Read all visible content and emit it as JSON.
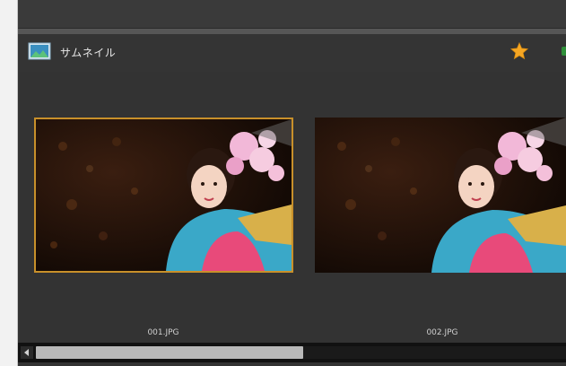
{
  "panel": {
    "title": "サムネイル",
    "icons": {
      "panel": "thumbnail-panel-icon",
      "favorite": "star-icon",
      "scroll_left": "scroll-left-arrow-icon"
    }
  },
  "thumbnails": [
    {
      "filename": "001.JPG",
      "selected": true
    },
    {
      "filename": "002.JPG",
      "selected": false
    }
  ],
  "scrollbar": {
    "position_fraction": 0.0
  },
  "colors": {
    "selection": "#c8902a",
    "favorite": "#f5a623",
    "background": "#333333"
  }
}
